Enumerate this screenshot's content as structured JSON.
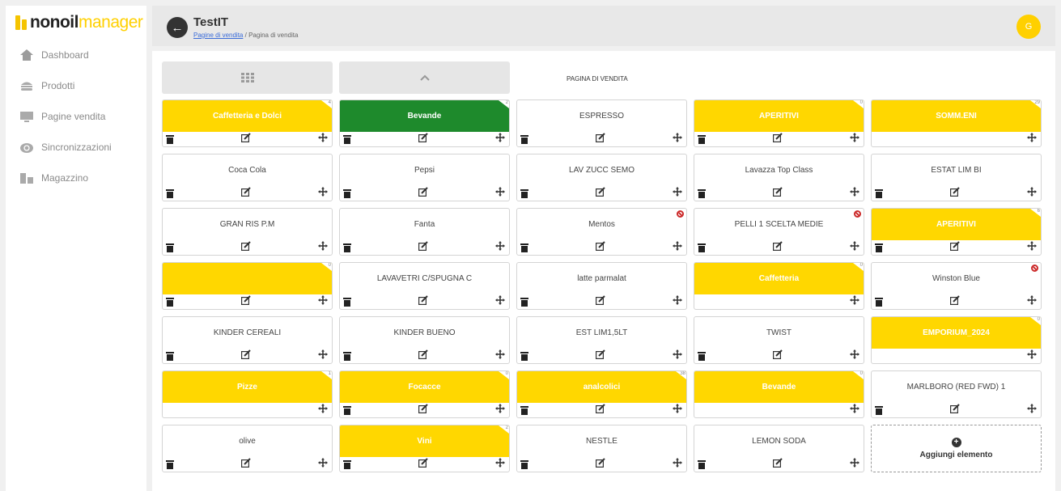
{
  "brand": {
    "part1": "nonoil",
    "part2": "manager"
  },
  "sidebar": {
    "items": [
      {
        "label": "Dashboard",
        "icon": "home-icon"
      },
      {
        "label": "Prodotti",
        "icon": "burger-icon"
      },
      {
        "label": "Pagine vendita",
        "icon": "monitor-icon"
      },
      {
        "label": "Sincronizzazioni",
        "icon": "cloud-sync-icon"
      },
      {
        "label": "Magazzino",
        "icon": "warehouse-icon"
      }
    ]
  },
  "header": {
    "title": "TestIT",
    "breadcrumb_link": "Pagine di vendita",
    "breadcrumb_current": "Pagina di vendita",
    "avatar": "G"
  },
  "toolbar": {
    "page_label": "PAGINA DI VENDITA"
  },
  "add_label": "Aggiungi elemento",
  "colors": {
    "yellow": "#ffd700",
    "green": "#1e8a2c"
  },
  "cards": [
    {
      "label": "Caffetteria e Dolci",
      "style": "yellow",
      "badge": "4",
      "actions": "full"
    },
    {
      "label": "Bevande",
      "style": "green",
      "badge": "2",
      "actions": "full"
    },
    {
      "label": "ESPRESSO",
      "style": "white",
      "badge": "",
      "actions": "full"
    },
    {
      "label": "APERITIVI",
      "style": "yellow",
      "badge": "0",
      "actions": "full"
    },
    {
      "label": "SOMM.ENI",
      "style": "yellow",
      "badge": "29",
      "actions": "move"
    },
    {
      "label": "Coca Cola",
      "style": "white",
      "badge": "",
      "actions": "full"
    },
    {
      "label": "Pepsi",
      "style": "white",
      "badge": "",
      "actions": "full"
    },
    {
      "label": "LAV ZUCC SEMO",
      "style": "white",
      "badge": "",
      "actions": "full"
    },
    {
      "label": "Lavazza Top Class",
      "style": "white",
      "badge": "",
      "actions": "full"
    },
    {
      "label": "ESTAT LIM BI",
      "style": "white",
      "badge": "",
      "actions": "full"
    },
    {
      "label": "GRAN RIS P.M",
      "style": "white",
      "badge": "",
      "actions": "full"
    },
    {
      "label": "Fanta",
      "style": "white",
      "badge": "",
      "actions": "full"
    },
    {
      "label": "Mentos",
      "style": "white",
      "badge": "",
      "actions": "full",
      "blocked": true
    },
    {
      "label": "PELLI 1 SCELTA MEDIE",
      "style": "white",
      "badge": "",
      "actions": "full",
      "blocked": true
    },
    {
      "label": "APERITIVI",
      "style": "yellow",
      "badge": "6",
      "actions": "full"
    },
    {
      "label": "",
      "style": "yellow",
      "badge": "0",
      "actions": "full"
    },
    {
      "label": "LAVAVETRI C/SPUGNA C",
      "style": "white",
      "badge": "",
      "actions": "full"
    },
    {
      "label": "latte parmalat",
      "style": "white",
      "badge": "",
      "actions": "full"
    },
    {
      "label": "Caffetteria",
      "style": "yellow",
      "badge": "0",
      "actions": "move"
    },
    {
      "label": "Winston Blue",
      "style": "white",
      "badge": "",
      "actions": "full",
      "blocked": true
    },
    {
      "label": "KINDER CEREALI",
      "style": "white",
      "badge": "",
      "actions": "full"
    },
    {
      "label": "KINDER BUENO",
      "style": "white",
      "badge": "",
      "actions": "full"
    },
    {
      "label": "EST LIM1,5LT",
      "style": "white",
      "badge": "",
      "actions": "full"
    },
    {
      "label": "TWIST",
      "style": "white",
      "badge": "",
      "actions": "full"
    },
    {
      "label": "EMPORIUM_2024",
      "style": "yellow",
      "badge": "0",
      "actions": "move"
    },
    {
      "label": "Pizze",
      "style": "yellow",
      "badge": "1",
      "actions": "move"
    },
    {
      "label": "Focacce",
      "style": "yellow",
      "badge": "0",
      "actions": "full"
    },
    {
      "label": "analcolici",
      "style": "yellow",
      "badge": "38",
      "actions": "full"
    },
    {
      "label": "Bevande",
      "style": "yellow",
      "badge": "0",
      "actions": "move"
    },
    {
      "label": "MARLBORO (RED FWD) 1",
      "style": "white",
      "badge": "",
      "actions": "full"
    },
    {
      "label": "olive",
      "style": "white",
      "badge": "",
      "actions": "full"
    },
    {
      "label": "Vini",
      "style": "yellow",
      "badge": "2",
      "actions": "full"
    },
    {
      "label": "NESTLE",
      "style": "white",
      "badge": "",
      "actions": "full"
    },
    {
      "label": "LEMON SODA",
      "style": "white",
      "badge": "",
      "actions": "full"
    }
  ]
}
